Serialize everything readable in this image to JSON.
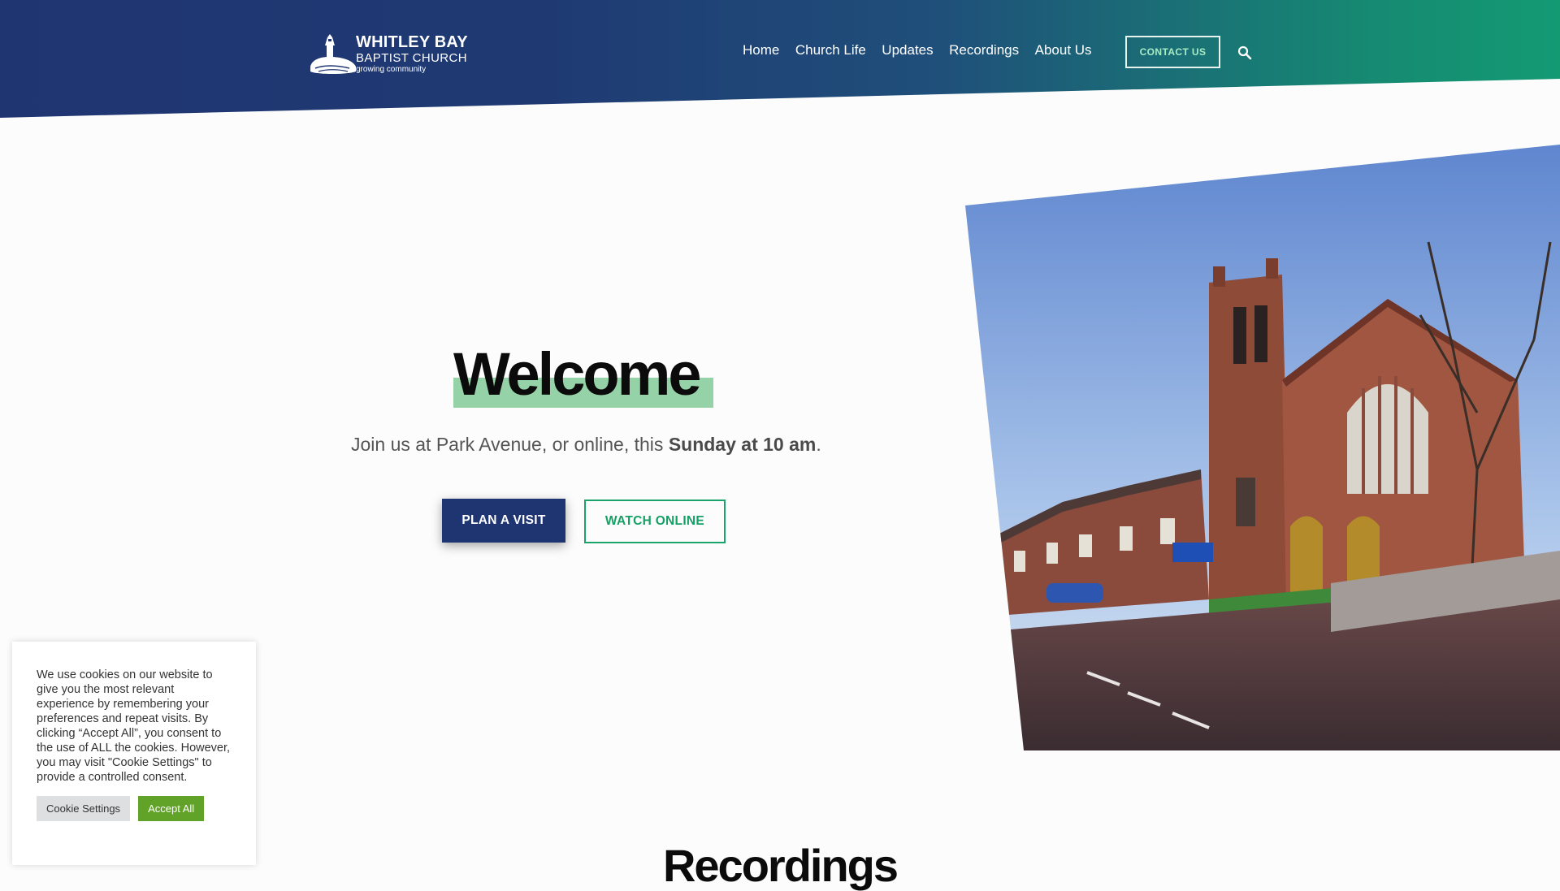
{
  "brand": {
    "line1": "WHITLEY BAY",
    "line2": "BAPTIST CHURCH",
    "line3": "growing community"
  },
  "nav": {
    "items": [
      "Home",
      "Church Life",
      "Updates",
      "Recordings",
      "About Us"
    ],
    "contact_label": "CONTACT US",
    "search_icon": "search-icon"
  },
  "hero": {
    "title": "Welcome",
    "subtitle_prefix": "Join us at Park Avenue, or online, this ",
    "subtitle_bold": "Sunday at 10 am",
    "subtitle_suffix": ".",
    "primary_button": "PLAN A VISIT",
    "secondary_button": "WATCH ONLINE"
  },
  "section": {
    "heading": "Recordings"
  },
  "cookie": {
    "text": "We use cookies on our website to give you the most relevant experience by remembering your preferences and repeat visits. By clicking “Accept All”, you consent to the use of ALL the cookies. However, you may visit \"Cookie Settings\" to provide a controlled consent.",
    "settings_label": "Cookie Settings",
    "accept_label": "Accept All"
  },
  "colors": {
    "header_left": "#1f3572",
    "header_right": "#139a73",
    "primary_button": "#1f3572",
    "accent_green": "#1aa36a",
    "highlight": "#96d2a8",
    "cookie_accept": "#61a229"
  }
}
